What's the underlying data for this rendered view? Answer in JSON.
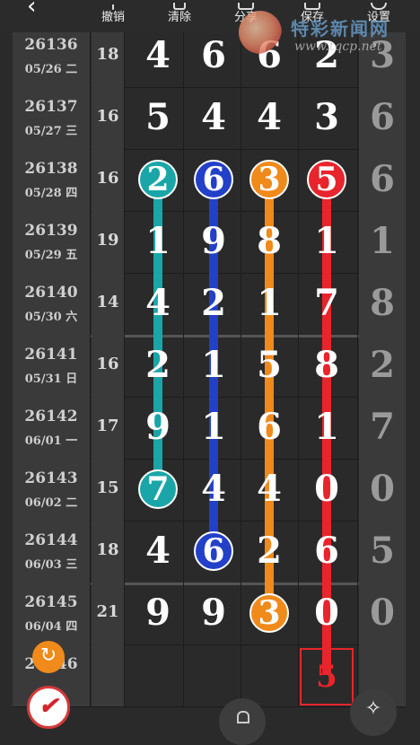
{
  "toolbar": {
    "undo_label": "撤销",
    "clear_label": "清除",
    "share_label": "分享",
    "save_label": "保存",
    "settings_label": "设置"
  },
  "watermark": {
    "site_name": "特彩新闻网",
    "url": "www.tqcp.net"
  },
  "columns": [
    "issue",
    "sum",
    "d1",
    "d2",
    "d3",
    "d4",
    "last"
  ],
  "rows": [
    {
      "issue": "26136",
      "date": "05/26 二",
      "sum": "18",
      "digits": [
        "4",
        "6",
        "6",
        "2"
      ],
      "last": "3"
    },
    {
      "issue": "26137",
      "date": "05/27 三",
      "sum": "16",
      "digits": [
        "5",
        "4",
        "4",
        "3"
      ],
      "last": "6"
    },
    {
      "issue": "26138",
      "date": "05/28 四",
      "sum": "16",
      "digits": [
        "2",
        "6",
        "3",
        "5"
      ],
      "last": "6"
    },
    {
      "issue": "26139",
      "date": "05/29 五",
      "sum": "19",
      "digits": [
        "1",
        "9",
        "8",
        "1"
      ],
      "last": "1"
    },
    {
      "issue": "26140",
      "date": "05/30 六",
      "sum": "14",
      "digits": [
        "4",
        "2",
        "1",
        "7"
      ],
      "last": "8"
    },
    {
      "issue": "26141",
      "date": "05/31 日",
      "sum": "16",
      "digits": [
        "2",
        "1",
        "5",
        "8"
      ],
      "last": "2"
    },
    {
      "issue": "26142",
      "date": "06/01 一",
      "sum": "17",
      "digits": [
        "9",
        "1",
        "6",
        "1"
      ],
      "last": "7"
    },
    {
      "issue": "26143",
      "date": "06/02 二",
      "sum": "15",
      "digits": [
        "7",
        "4",
        "4",
        "0"
      ],
      "last": "0"
    },
    {
      "issue": "26144",
      "date": "06/03 三",
      "sum": "18",
      "digits": [
        "4",
        "6",
        "2",
        "6"
      ],
      "last": "5"
    },
    {
      "issue": "26145",
      "date": "06/04 四",
      "sum": "21",
      "digits": [
        "9",
        "9",
        "3",
        "0"
      ],
      "last": "0"
    },
    {
      "issue": "26146",
      "date": "",
      "sum": "",
      "digits": [
        "",
        "",
        "",
        ""
      ],
      "last": ""
    }
  ],
  "colors": {
    "teal": "#1aa6a8",
    "blue": "#2340c8",
    "orange": "#f08a1a",
    "red": "#e8242c"
  },
  "prediction": "5",
  "icons": [
    "back-icon",
    "undo-icon",
    "clear-icon",
    "share-icon",
    "save-icon",
    "settings-icon",
    "refresh-icon",
    "brand-logo-icon",
    "lock-icon",
    "pen-icon"
  ]
}
